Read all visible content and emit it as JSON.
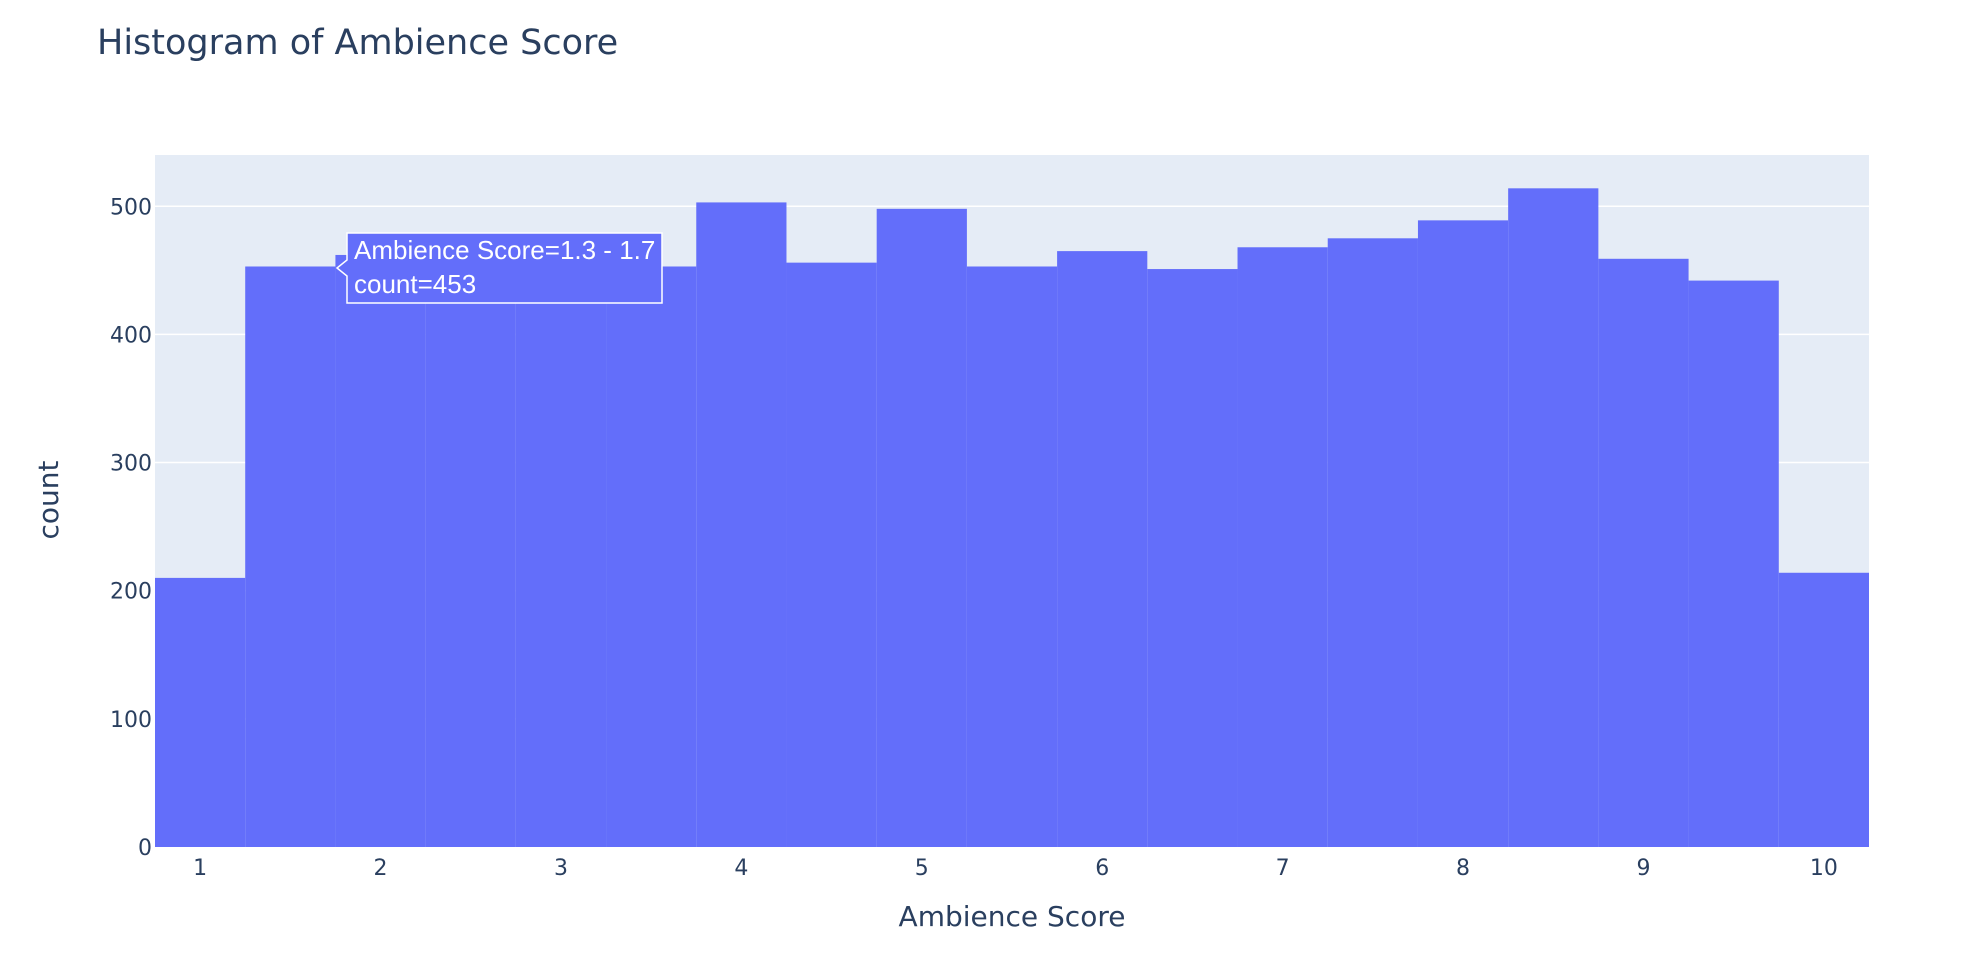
{
  "chart_data": {
    "type": "bar",
    "title": "Histogram of Ambience Score",
    "xlabel": "Ambience Score",
    "ylabel": "count",
    "bin_edges": [
      0.75,
      1.25,
      1.75,
      2.25,
      2.75,
      3.25,
      3.75,
      4.25,
      4.75,
      5.25,
      5.75,
      6.25,
      6.75,
      7.25,
      7.75,
      8.25,
      8.75,
      9.25,
      9.75,
      10.25
    ],
    "values": [
      210,
      453,
      462,
      452,
      452,
      453,
      503,
      456,
      498,
      453,
      465,
      451,
      468,
      475,
      489,
      514,
      459,
      442,
      214
    ],
    "xlim": [
      0.75,
      10.25
    ],
    "ylim": [
      0,
      540
    ],
    "x_ticks": [
      1,
      2,
      3,
      4,
      5,
      6,
      7,
      8,
      9,
      10
    ],
    "y_ticks": [
      0,
      100,
      200,
      300,
      400,
      500
    ],
    "bar_color": "#636efa",
    "plot_bgcolor": "#e5ecf6",
    "grid": true,
    "legend": "none"
  },
  "tooltip": {
    "line1": "Ambience Score=1.3 - 1.7",
    "line2": "count=453"
  }
}
